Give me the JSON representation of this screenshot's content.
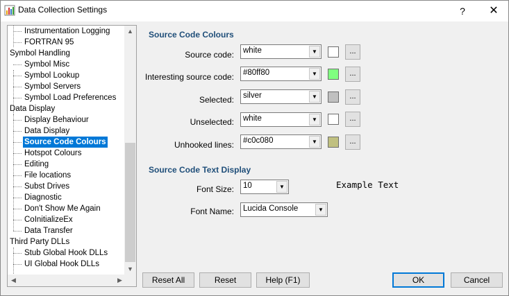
{
  "window": {
    "title": "Data Collection Settings",
    "help_label": "?",
    "close_label": "✕"
  },
  "tree": {
    "items": [
      {
        "label": "Instrumentation Logging",
        "level": 1
      },
      {
        "label": "FORTRAN 95",
        "level": 1
      },
      {
        "label": "Symbol Handling",
        "level": 0
      },
      {
        "label": "Symbol Misc",
        "level": 1
      },
      {
        "label": "Symbol Lookup",
        "level": 1
      },
      {
        "label": "Symbol Servers",
        "level": 1
      },
      {
        "label": "Symbol Load Preferences",
        "level": 1
      },
      {
        "label": "Data Display",
        "level": 0
      },
      {
        "label": "Display Behaviour",
        "level": 1
      },
      {
        "label": "Data Display",
        "level": 1
      },
      {
        "label": "Source Code Colours",
        "level": 1,
        "selected": true
      },
      {
        "label": "Hotspot Colours",
        "level": 1
      },
      {
        "label": "Editing",
        "level": 1
      },
      {
        "label": "File locations",
        "level": 1
      },
      {
        "label": "Subst Drives",
        "level": 1
      },
      {
        "label": "Diagnostic",
        "level": 1
      },
      {
        "label": "Don't Show Me Again",
        "level": 1
      },
      {
        "label": "CoInitializeEx",
        "level": 1
      },
      {
        "label": "Data Transfer",
        "level": 1
      },
      {
        "label": "Third Party DLLs",
        "level": 0
      },
      {
        "label": "Stub Global Hook DLLs",
        "level": 1
      },
      {
        "label": "UI Global Hook DLLs",
        "level": 1
      }
    ]
  },
  "colours": {
    "heading": "Source Code Colours",
    "rows": [
      {
        "label": "Source code:",
        "value": "white",
        "swatch": "#ffffff",
        "button": "..."
      },
      {
        "label": "Interesting source code:",
        "value": "#80ff80",
        "swatch": "#80ff80",
        "button": "..."
      },
      {
        "label": "Selected:",
        "value": "silver",
        "swatch": "#c0c0c0",
        "button": "..."
      },
      {
        "label": "Unselected:",
        "value": "white",
        "swatch": "#ffffff",
        "button": "..."
      },
      {
        "label": "Unhooked lines:",
        "value": "#c0c080",
        "swatch": "#c0c080",
        "button": "..."
      }
    ]
  },
  "text_display": {
    "heading": "Source Code Text Display",
    "font_size_label": "Font Size:",
    "font_size_value": "10",
    "font_name_label": "Font Name:",
    "font_name_value": "Lucida Console",
    "example_text": "Example Text"
  },
  "buttons": {
    "reset_all": "Reset All",
    "reset": "Reset",
    "help": "Help (F1)",
    "ok": "OK",
    "cancel": "Cancel"
  }
}
